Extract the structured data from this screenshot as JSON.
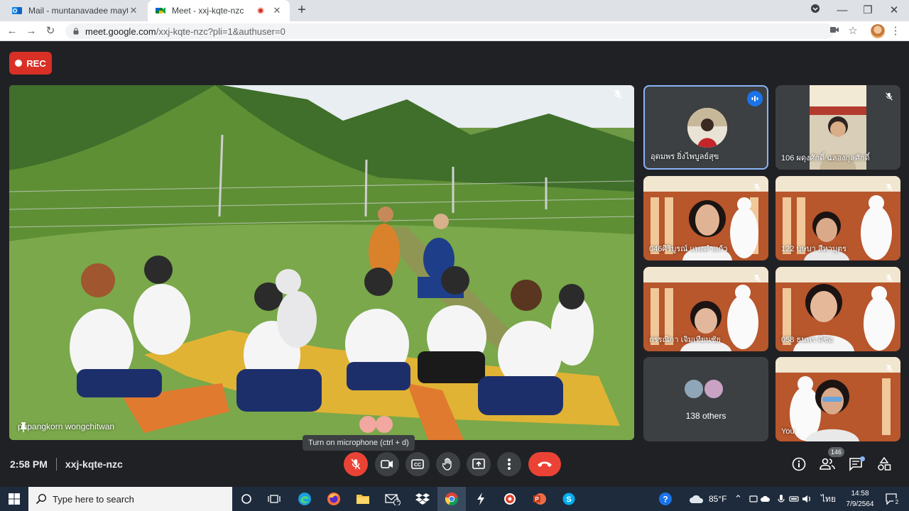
{
  "browser": {
    "tabs": [
      {
        "title": "Mail - muntanavadee maytapatta",
        "close": "✕"
      },
      {
        "title": "Meet - xxj-kqte-nzc",
        "close": "✕"
      }
    ],
    "new_tab": "+",
    "window_controls": {
      "minimize": "—",
      "maximize": "❐",
      "close": "✕"
    },
    "url_host": "meet.google.com",
    "url_path": "/xxj-kqte-nzc?pli=1&authuser=0"
  },
  "meet": {
    "rec_label": "REC",
    "main_participant": "papangkorn wongchitwan",
    "participants": [
      {
        "name": "อุดมพร ยิ่งไพบูลย์สุข",
        "speaking": true
      },
      {
        "name": "106 ผดุงศักดิ์ ฉลองกุลศักดิ์"
      },
      {
        "name": "046ศิริบูรณ์ แพงคำแก้ว"
      },
      {
        "name": "122 บุษบา สีหาบุตร"
      },
      {
        "name": "กรรณิกา เจิมเทียนชัย"
      },
      {
        "name": "058 ธนพร ดีช่อ"
      },
      {
        "name": "138 others"
      },
      {
        "name": "You"
      }
    ],
    "tooltip": "Turn on microphone (ctrl + d)",
    "time": "2:58 PM",
    "meeting_code": "xxj-kqte-nzc",
    "people_count": "146"
  },
  "taskbar": {
    "search_placeholder": "Type here to search",
    "weather": "85°F",
    "language": "ไทย",
    "clock_time": "14:58",
    "clock_date": "7/9/2564",
    "notification_count": "2",
    "mail_badge": "1"
  },
  "colors": {
    "meet_bg": "#202124",
    "rec_red": "#d93025",
    "end_call_red": "#ea4335",
    "speaking_blue": "#8ab4f8",
    "taskbar": "#1e2b3c"
  }
}
